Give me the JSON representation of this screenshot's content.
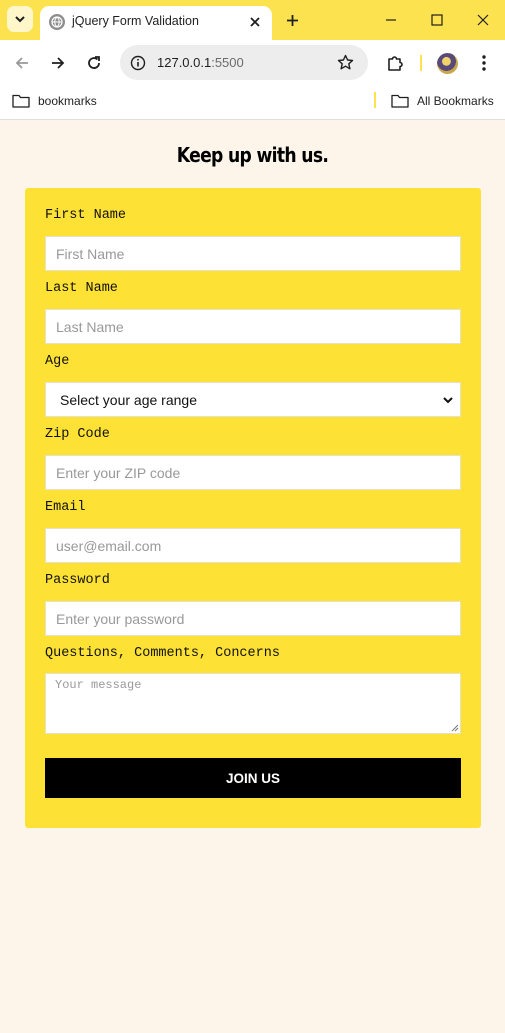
{
  "browser": {
    "tab_title": "jQuery Form Validation",
    "url_host": "127.0.0.1",
    "url_port": ":5500",
    "bookmarks": [
      {
        "label": "bookmarks"
      },
      {
        "label": "All Bookmarks"
      }
    ]
  },
  "page": {
    "heading": "Keep up with us.",
    "form": {
      "fields": [
        {
          "label": "First Name",
          "placeholder": "First Name"
        },
        {
          "label": "Last Name",
          "placeholder": "Last Name"
        },
        {
          "label": "Age",
          "value": "Select your age range"
        },
        {
          "label": "Zip Code",
          "placeholder": "Enter your ZIP code"
        },
        {
          "label": "Email",
          "placeholder": "user@email.com"
        },
        {
          "label": "Password",
          "placeholder": "Enter your password"
        },
        {
          "label": "Questions, Comments, Concerns",
          "placeholder": "Your message"
        }
      ],
      "submit_label": "JOIN US"
    }
  }
}
